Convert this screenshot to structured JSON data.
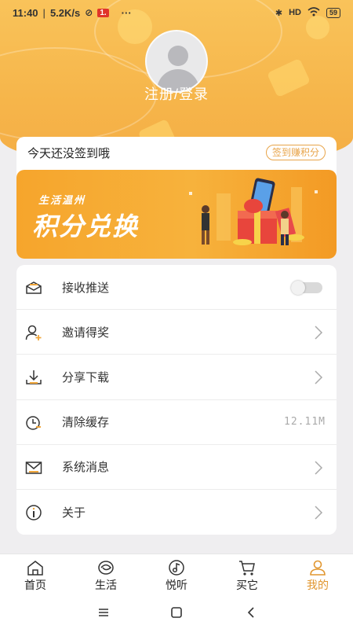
{
  "statusbar": {
    "time": "11:40",
    "net_speed": "5.2K/s",
    "notif_badge": "1.",
    "more": "···",
    "signal": "HD",
    "battery": "59"
  },
  "profile": {
    "login_text": "注册/登录"
  },
  "signin": {
    "text": "今天还没签到哦",
    "button": "签到赚积分"
  },
  "banner": {
    "subtitle": "生活温州",
    "title": "积分兑换"
  },
  "menu": {
    "items": [
      {
        "label": "接收推送",
        "icon": "envelope-open-icon",
        "control": "toggle",
        "enabled": false
      },
      {
        "label": "邀请得奖",
        "icon": "add-user-icon",
        "control": "chevron"
      },
      {
        "label": "分享下载",
        "icon": "download-icon",
        "control": "chevron"
      },
      {
        "label": "清除缓存",
        "icon": "clock-clear-icon",
        "control": "value",
        "value": "12.11M"
      },
      {
        "label": "系统消息",
        "icon": "mail-icon",
        "control": "chevron"
      },
      {
        "label": "关于",
        "icon": "info-icon",
        "control": "chevron"
      }
    ]
  },
  "tabs": [
    {
      "label": "首页",
      "icon": "home-icon",
      "active": false
    },
    {
      "label": "生活",
      "icon": "life-icon",
      "active": false
    },
    {
      "label": "悦听",
      "icon": "music-icon",
      "active": false
    },
    {
      "label": "买它",
      "icon": "cart-icon",
      "active": false
    },
    {
      "label": "我的",
      "icon": "profile-icon",
      "active": true
    }
  ],
  "colors": {
    "accent": "#e1962f",
    "hero_bg": "#f7b84c",
    "banner_bg": "#f6a52c"
  }
}
